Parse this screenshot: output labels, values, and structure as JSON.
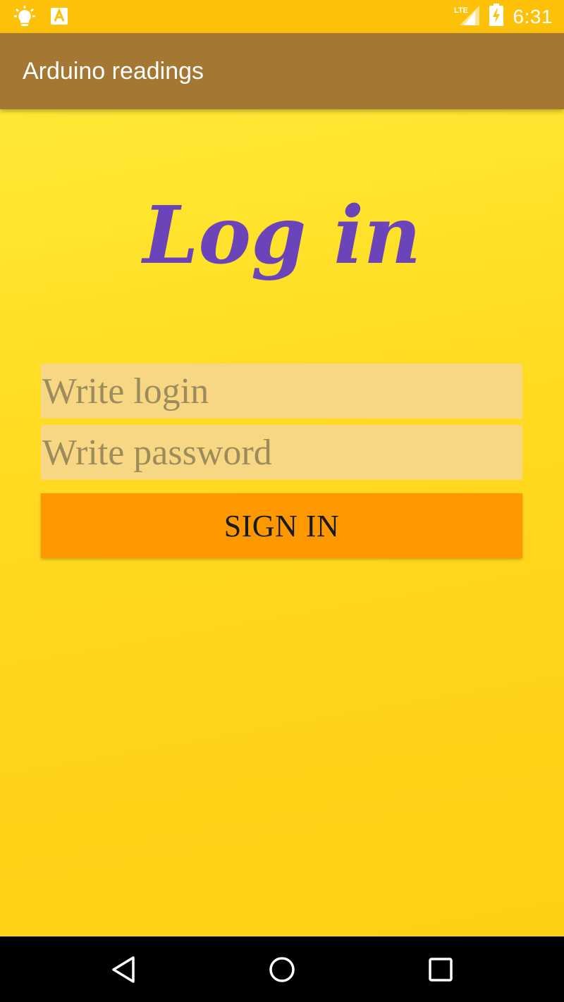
{
  "status_bar": {
    "time": "6:31",
    "network_label": "LTE",
    "icons": [
      "lightbulb-icon",
      "text-a-icon",
      "lte-signal-icon",
      "battery-charging-icon"
    ]
  },
  "app_bar": {
    "title": "Arduino readings"
  },
  "login_form": {
    "heading": "Log in",
    "login_placeholder": "Write login",
    "login_value": "",
    "password_placeholder": "Write password",
    "password_value": "",
    "sign_in_label": "SIGN IN"
  },
  "nav_bar": {
    "icons": [
      "back-icon",
      "home-icon",
      "recents-icon"
    ]
  },
  "colors": {
    "status_bar": "#fec10a",
    "app_bar": "#a47732",
    "background_top": "#ffe936",
    "background_bottom": "#ffcf14",
    "heading": "#6a44b8",
    "input_background": "#f7d784",
    "placeholder": "#9d8c5b",
    "button": "#fe9800"
  }
}
